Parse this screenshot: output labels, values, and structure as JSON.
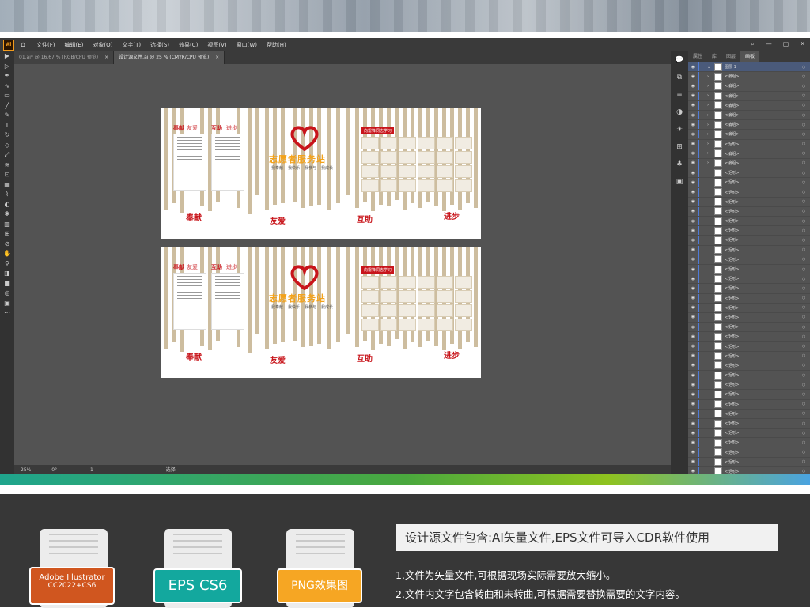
{
  "menu": {
    "app_badge": "Ai",
    "items": [
      "文件(F)",
      "编辑(E)",
      "对象(O)",
      "文字(T)",
      "选择(S)",
      "效果(C)",
      "视图(V)",
      "窗口(W)",
      "帮助(H)"
    ]
  },
  "tabs": [
    {
      "label": "01.ai* @ 16.67 % (RGB/CPU 预览)",
      "close": "×"
    },
    {
      "label": "设计源文件.ai @ 25 % (CMYK/CPU 预览)",
      "close": "×"
    }
  ],
  "artboard": {
    "panel1_head_a": "奉献",
    "panel1_head_b": "友爱",
    "panel2_head_a": "互助",
    "panel2_head_b": "进步",
    "station": "志愿者服务站",
    "slogan": [
      "我奉献",
      "我快乐",
      "我参与",
      "我成长"
    ],
    "board_title": "向雷锋同志学习",
    "words": [
      "奉献",
      "友爱",
      "互助",
      "进步"
    ]
  },
  "right_panel": {
    "tabs": [
      "属性",
      "库",
      "图层",
      "画板"
    ],
    "top_layer": "图层 1",
    "groups": [
      "<编组>",
      "<编组>",
      "<编组>",
      "<编组>",
      "<编组>",
      "<编组>",
      "<编组>",
      "<矩形>",
      "<编组>",
      "<编组>"
    ],
    "rect_label": "<矩形>"
  },
  "status": {
    "zoom": "25%",
    "angle": "0°",
    "page": "1",
    "tool": "选择"
  },
  "bottom": {
    "badges": [
      {
        "line1": "Adobe Illustrator",
        "line2": "CC2022+CS6",
        "color": "#d0561f"
      },
      {
        "line1": "EPS CS6",
        "line2": "",
        "color": "#13a89e"
      },
      {
        "line1": "PNG效果图",
        "line2": "",
        "color": "#f6a623"
      }
    ],
    "info": "设计源文件包含:AI矢量文件,EPS文件可导入CDR软件使用",
    "notes": [
      "1.文件为矢量文件,可根据现场实际需要放大缩小。",
      "2.文件内文字包含转曲和未转曲,可根据需要替换需要的文字内容。"
    ]
  }
}
